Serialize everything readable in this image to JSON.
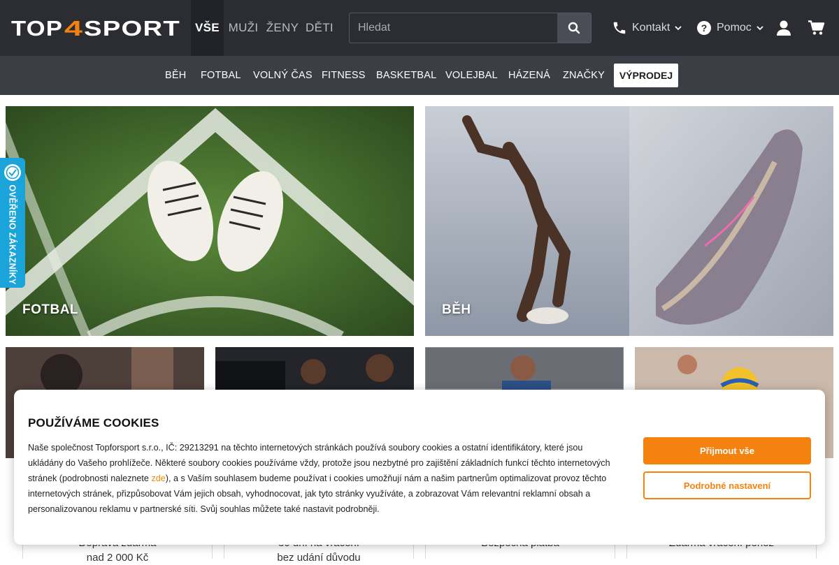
{
  "header": {
    "logo_text": "TOP4SPORT",
    "gender_tabs": [
      {
        "label": "VŠE"
      },
      {
        "label": "MUŽI"
      },
      {
        "label": "ŽENY"
      },
      {
        "label": "DĚTI"
      }
    ],
    "search": {
      "placeholder": "Hledat"
    },
    "contact_label": "Kontakt",
    "help_label": "Pomoc",
    "accent_color": "#f4820f"
  },
  "nav": {
    "items": [
      {
        "label": "BĚH"
      },
      {
        "label": "FOTBAL"
      },
      {
        "label": "VOLNÝ ČAS"
      },
      {
        "label": "FITNESS"
      },
      {
        "label": "BASKETBAL"
      },
      {
        "label": "VOLEJBAL"
      },
      {
        "label": "HÁZENÁ"
      },
      {
        "label": "ZNAČKY"
      }
    ],
    "sale_label": "VÝPRODEJ"
  },
  "badge": {
    "label": "OVĚŘENO ZÁKAZNÍKY"
  },
  "tiles": [
    {
      "label": "FOTBAL"
    },
    {
      "label": "BĚH"
    }
  ],
  "benefits": [
    {
      "line1": "Doprava zdarma",
      "line2": "nad 2 000 Kč"
    },
    {
      "line1": "30 dní na vrácení",
      "line2": "bez udání důvodu"
    },
    {
      "line1": "Bezpečná platba",
      "line2": ""
    },
    {
      "line1": "Zdarma vrácení peněz",
      "line2": ""
    }
  ],
  "cookies": {
    "title": "POUŽÍVÁME COOKIES",
    "text_before_link": "Naše společnost Topforsport s.r.o., IČ: 29213291 na těchto internetových stránkách používá soubory cookies a ostatní identifikátory, které jsou ukládány do Vašeho prohlížeče. Některé soubory cookies používáme vždy, protože jsou nezbytné pro zajištění základních funkcí těchto internetových stránek (podrobnosti naleznete ",
    "link_text": "zde",
    "text_after_link": "), a s Vaším souhlasem budeme používat i cookies umožňují nám a našim partnerům optimalizovat provoz těchto internetových stránek, přizpůsobovat Vám jejich obsah, vyhodnocovat, jak tyto stránky využíváte, a zobrazovat Vám relevantní reklamní obsah a personalizovanou reklamu v partnerské síti. Svůj souhlas můžete také nastavit podrobněji.",
    "accept_label": "Přijmout vše",
    "settings_label": "Podrobné nastavení"
  }
}
